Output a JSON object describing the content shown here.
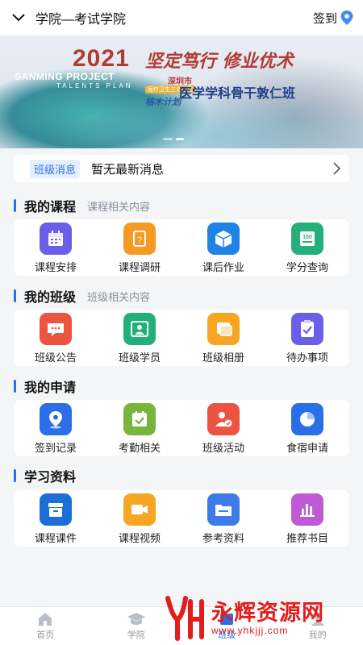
{
  "header": {
    "title": "学院—考试学院",
    "signin_label": "签到"
  },
  "banner": {
    "year": "2021",
    "project": "SANMING PROJECT",
    "plan": "TALENTS PLAN",
    "slogan": "坚定笃行 修业优术",
    "city": "深圳市",
    "tag": "医疗卫生三名工程",
    "logo_text": "格木计划",
    "course": "医学学科骨干敦仁班"
  },
  "message": {
    "badge": "班级消息",
    "text": "暂无最新消息"
  },
  "sections": [
    {
      "title": "我的课程",
      "subtitle": "课程相关内容",
      "items": [
        {
          "label": "课程安排",
          "icon": "calendar-icon",
          "color": "#6b5ee8"
        },
        {
          "label": "课程调研",
          "icon": "survey-icon",
          "color": "#f59b22"
        },
        {
          "label": "课后作业",
          "icon": "box-icon",
          "color": "#1f84e6"
        },
        {
          "label": "学分查询",
          "icon": "score-icon",
          "color": "#25b07a"
        }
      ]
    },
    {
      "title": "我的班级",
      "subtitle": "班级相关内容",
      "items": [
        {
          "label": "班级公告",
          "icon": "notice-icon",
          "color": "#ec5340"
        },
        {
          "label": "班级学员",
          "icon": "member-icon",
          "color": "#20b07a"
        },
        {
          "label": "班级相册",
          "icon": "album-icon",
          "color": "#f7a623"
        },
        {
          "label": "待办事项",
          "icon": "todo-icon",
          "color": "#6b5ee8"
        }
      ]
    },
    {
      "title": "我的申请",
      "subtitle": "",
      "items": [
        {
          "label": "签到记录",
          "icon": "location-icon",
          "color": "#2a6fe8"
        },
        {
          "label": "考勤相关",
          "icon": "attendance-icon",
          "color": "#77b53c"
        },
        {
          "label": "班级活动",
          "icon": "activity-icon",
          "color": "#ec5340"
        },
        {
          "label": "食宿申请",
          "icon": "pie-icon",
          "color": "#2a6fe8"
        }
      ]
    },
    {
      "title": "学习资料",
      "subtitle": "",
      "items": [
        {
          "label": "课程课件",
          "icon": "archive-icon",
          "color": "#1c6fd6"
        },
        {
          "label": "课程视频",
          "icon": "video-icon",
          "color": "#f7a623"
        },
        {
          "label": "参考资料",
          "icon": "folder-icon",
          "color": "#3d7ce8"
        },
        {
          "label": "推荐书目",
          "icon": "chart-icon",
          "color": "#c059d4"
        }
      ]
    }
  ],
  "tabbar": [
    {
      "label": "首页",
      "icon": "home-icon"
    },
    {
      "label": "学院",
      "icon": "academy-icon"
    },
    {
      "label": "班级",
      "icon": "class-icon"
    },
    {
      "label": "我的",
      "icon": "profile-icon"
    }
  ],
  "watermark": {
    "text": "永辉资源网",
    "url": "www.yhkjjj.com"
  },
  "colors": {
    "accent": "#2a6fe8",
    "background": "#f4f5f7"
  }
}
